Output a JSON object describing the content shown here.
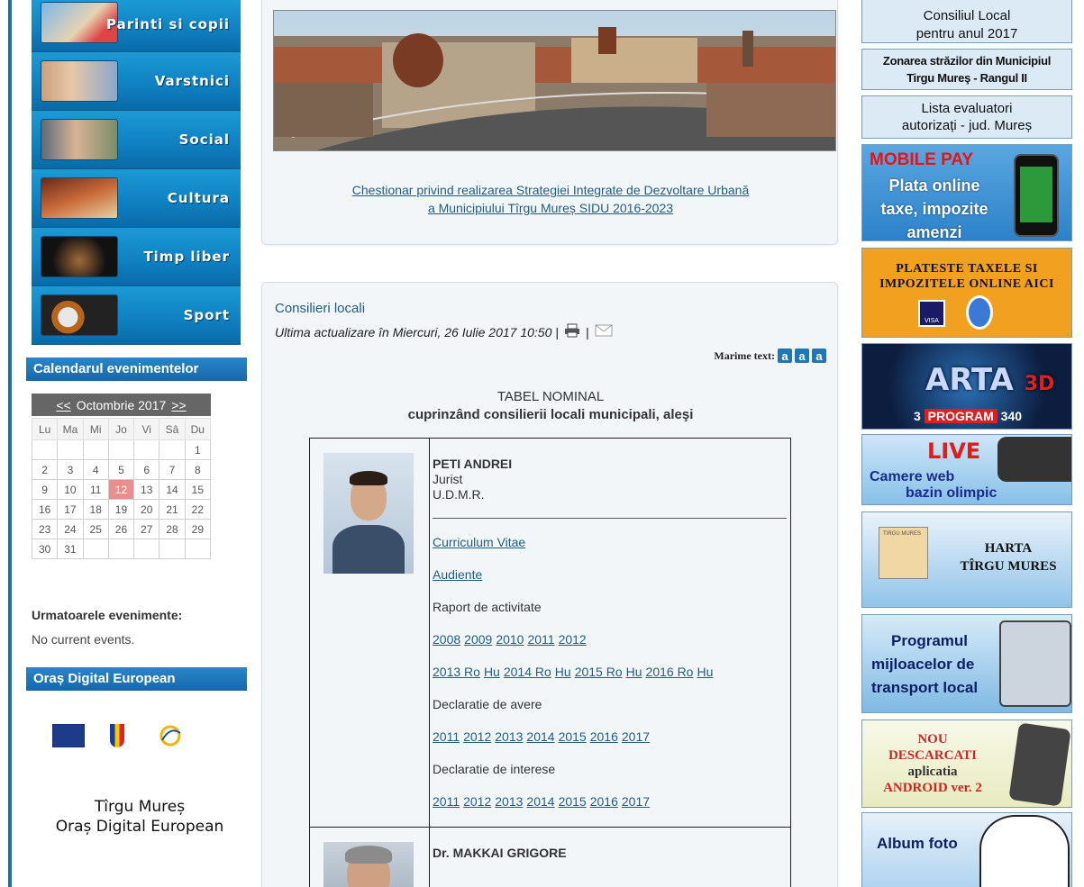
{
  "left_menu": {
    "items": [
      {
        "label": "Parinti si copii"
      },
      {
        "label": "Varstnici"
      },
      {
        "label": "Social"
      },
      {
        "label": "Cultura"
      },
      {
        "label": "Timp liber"
      },
      {
        "label": "Sport"
      }
    ]
  },
  "calendar": {
    "header": "Calendarul evenimentelor",
    "prev": "<<",
    "month": "Octombrie 2017",
    "next": ">>",
    "weekdays": [
      "Lu",
      "Ma",
      "Mi",
      "Jo",
      "Vi",
      "Sâ",
      "Du"
    ],
    "today": "12",
    "weeks": [
      [
        "",
        "",
        "",
        "",
        "",
        "",
        "1"
      ],
      [
        "2",
        "3",
        "4",
        "5",
        "6",
        "7",
        "8"
      ],
      [
        "9",
        "10",
        "11",
        "12",
        "13",
        "14",
        "15"
      ],
      [
        "16",
        "17",
        "18",
        "19",
        "20",
        "21",
        "22"
      ],
      [
        "23",
        "24",
        "25",
        "26",
        "27",
        "28",
        "29"
      ],
      [
        "30",
        "31",
        "",
        "",
        "",
        "",
        ""
      ]
    ],
    "events_title": "Urmatoarele evenimente:",
    "events_none": "No current events."
  },
  "digital": {
    "header": "Oraș Digital European",
    "line1": "Tîrgu Mureș",
    "line2": "Oraș Digital European"
  },
  "center": {
    "chestionar_line1": "Chestionar privind realizarea Strategiei Integrate de Dezvoltare Urbană",
    "chestionar_line2": "a Municipiului Tîrgu Mureș SIDU 2016-2023",
    "article_title": "Consilieri locali",
    "updated": "Ultima actualizare în Miercuri, 26 Iulie 2017 10:50 |",
    "pipe": "|",
    "text_size_label": "Marime text:",
    "text_size_buttons": [
      "a",
      "a",
      "a"
    ],
    "table_title": "TABEL NOMINAL",
    "table_subtitle": "cuprinzând consilierii locali municipali, aleşi",
    "persons": [
      {
        "name": "PETI ANDREI",
        "profession": "Jurist",
        "party": "U.D.M.R.",
        "cv": "Curriculum Vitae",
        "audiente": "Audiente",
        "raport_label": "Raport de activitate",
        "raport_years_row1": [
          "2008",
          "2009",
          "2010",
          "2011",
          "2012"
        ],
        "raport_years_row2": [
          "2013 Ro",
          "Hu",
          "2014 Ro",
          "Hu",
          "2015 Ro",
          "Hu",
          "2016 Ro",
          "Hu"
        ],
        "avere_label": "Declaratie de avere",
        "avere_years": [
          "2011",
          "2012",
          "2013",
          "2014",
          "2015",
          "2016",
          "2017"
        ],
        "interese_label": "Declaratie de interese",
        "interese_years": [
          "2011",
          "2012",
          "2013",
          "2014",
          "2015",
          "2016",
          "2017"
        ]
      },
      {
        "name": "Dr. MAKKAI GRIGORE"
      }
    ]
  },
  "right_banners": {
    "consiliu_line1": "Consiliul Local",
    "consiliu_line2": "pentru anul 2017",
    "zonarea_line1": "Zonarea străzilor din Municipiul",
    "zonarea_line2": "Tirgu Mureş - Rangul II",
    "evaluatori_line1": "Lista evaluatori",
    "evaluatori_line2": "autorizați - jud. Mureș",
    "mobile_pay": "MOBILE PAY",
    "mobile_line1": "Plata online",
    "mobile_line2": "taxe, impozite",
    "mobile_line3": "amenzi",
    "plateste_line1": "PLATESTE TAXELE SI",
    "plateste_line2": "IMPOZITELE ONLINE AICI",
    "card_label": "VISA",
    "arta": "ARTA",
    "arta_3d": "3D",
    "arta_prog": "PROGRAM",
    "arta_3": "3",
    "arta_340": "340",
    "live": "LIVE",
    "camere_line1": "Camere web",
    "camere_line2": "bazin olimpic",
    "harta_map_label": "TIRGU MURES",
    "harta_line1": "HARTA",
    "harta_line2": "TÎRGU MURES",
    "transport_line1": "Programul",
    "transport_line2": "mijloacelor de",
    "transport_line3": "transport local",
    "nou": "NOU",
    "descarcati": "DESCARCATI",
    "aplicatia": "aplicatia",
    "android": "ANDROID ver. 2",
    "album": "Album foto"
  }
}
